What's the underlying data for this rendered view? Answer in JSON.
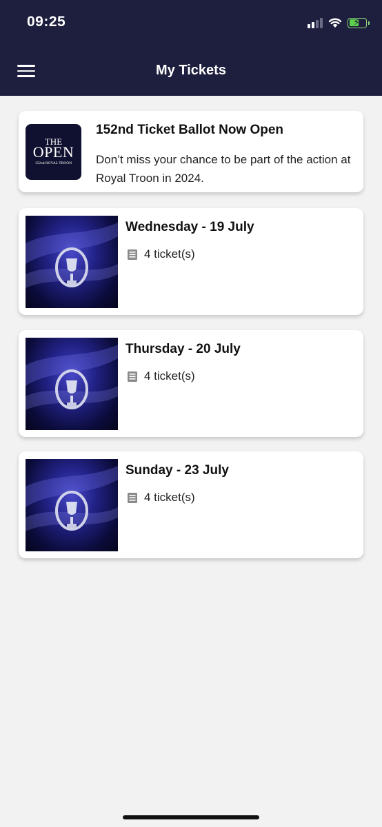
{
  "status_bar": {
    "time": "09:25"
  },
  "header": {
    "title": "My Tickets"
  },
  "ballot": {
    "logo": {
      "line1": "THE",
      "line2": "OPEN",
      "line3": "152nd ROYAL TROON"
    },
    "title": "152nd Ticket Ballot Now Open",
    "description": "Don’t miss your chance to be part of the action at Royal Troon in 2024."
  },
  "tickets": [
    {
      "day": "Wednesday - 19 July",
      "count": "4 ticket(s)"
    },
    {
      "day": "Thursday - 20 July",
      "count": "4 ticket(s)"
    },
    {
      "day": "Sunday - 23 July",
      "count": "4 ticket(s)"
    }
  ],
  "icons": {
    "menu": "hamburger-menu-icon",
    "ticket": "ticket-list-icon",
    "signal": "cellular-signal-icon",
    "wifi": "wifi-icon",
    "battery": "battery-charging-icon"
  },
  "colors": {
    "header_bg": "#1e1e3e",
    "background": "#f2f2f2",
    "card": "#ffffff",
    "battery": "#5dd04c"
  }
}
